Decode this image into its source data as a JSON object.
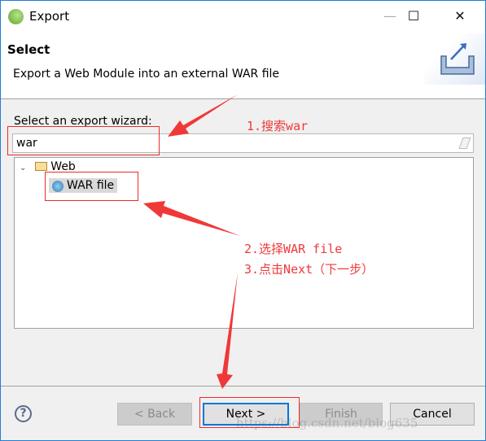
{
  "window": {
    "title": "Export",
    "minimize": "—",
    "maximize": "☐",
    "close": "✕"
  },
  "header": {
    "title": "Select",
    "description": "Export a Web Module into an external WAR file",
    "icon": "export-wizard-icon"
  },
  "wizard": {
    "label": "Select an export wizard:",
    "search_value": "war",
    "search_clear_icon": "eraser-icon"
  },
  "tree": {
    "category": "Web",
    "item": "WAR file",
    "expand_icon": "chevron-down-icon",
    "folder_icon": "folder-open-icon",
    "item_icon": "war-file-icon"
  },
  "buttons": {
    "help": "?",
    "back": "< Back",
    "next": "Next >",
    "finish": "Finish",
    "cancel": "Cancel"
  },
  "annotations": {
    "step1": "1.搜索war",
    "step2": "2.选择WAR file",
    "step3": "3.点击Next（下一步）",
    "color": "#f03838"
  },
  "watermark": "https://blog.csdn.net/blog635"
}
